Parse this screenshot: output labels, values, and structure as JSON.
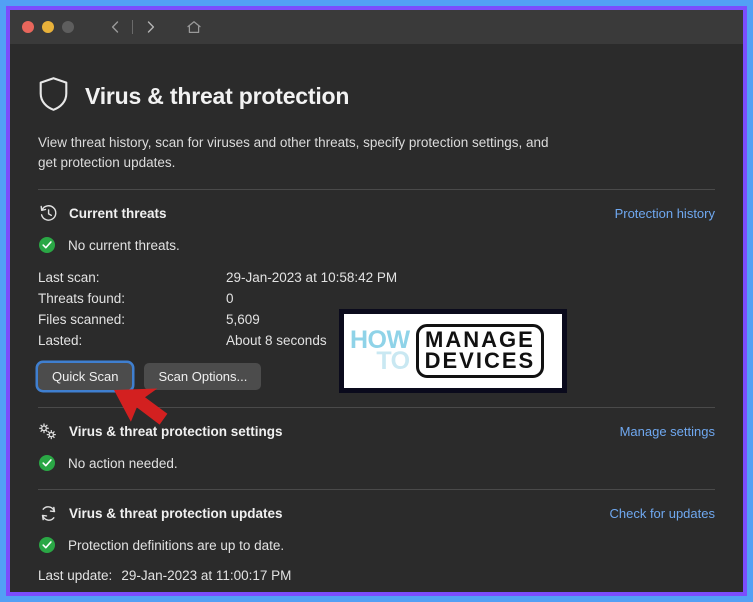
{
  "window": {
    "titlebar": {
      "traffic_lights": [
        "close",
        "minimize",
        "maximize"
      ],
      "nav": {
        "back_icon": "chevron-left-icon",
        "forward_icon": "chevron-right-icon",
        "home_icon": "home-icon"
      }
    }
  },
  "page": {
    "icon": "shield-icon",
    "title": "Virus & threat protection",
    "description": "View threat history, scan for viruses and other threats, specify protection settings, and get protection updates."
  },
  "current_threats": {
    "icon": "history-clock-icon",
    "heading": "Current threats",
    "link": "Protection history",
    "status_icon": "green-check-icon",
    "status": "No current threats.",
    "details": [
      {
        "label": "Last scan:",
        "value": "29-Jan-2023 at 10:58:42 PM"
      },
      {
        "label": "Threats found:",
        "value": "0"
      },
      {
        "label": "Files scanned:",
        "value": "5,609"
      },
      {
        "label": "Lasted:",
        "value": "About 8 seconds"
      }
    ],
    "buttons": {
      "quick_scan": "Quick Scan",
      "scan_options": "Scan Options..."
    }
  },
  "protection_settings": {
    "icon": "gear-settings-icon",
    "heading": "Virus & threat protection settings",
    "link": "Manage settings",
    "status_icon": "green-check-icon",
    "status": "No action needed."
  },
  "protection_updates": {
    "icon": "refresh-sync-icon",
    "heading": "Virus & threat protection updates",
    "link": "Check for updates",
    "status_icon": "green-check-icon",
    "status": "Protection definitions are up to date.",
    "last_update_label": "Last update:",
    "last_update_value": "29-Jan-2023 at 11:00:17 PM"
  },
  "watermark": {
    "how": "HOW",
    "to": "TO",
    "manage": "MANAGE",
    "devices": "DEVICES"
  },
  "colors": {
    "outer_border": "#52a0f5",
    "inner_border": "#7b4dfd",
    "window_bg": "#2b2b2b",
    "titlebar_bg": "#3a3a3a",
    "link": "#6fa8f0",
    "success": "#2aa745",
    "focus_ring": "#3f7fd0",
    "pointer_arrow": "#d32020"
  }
}
